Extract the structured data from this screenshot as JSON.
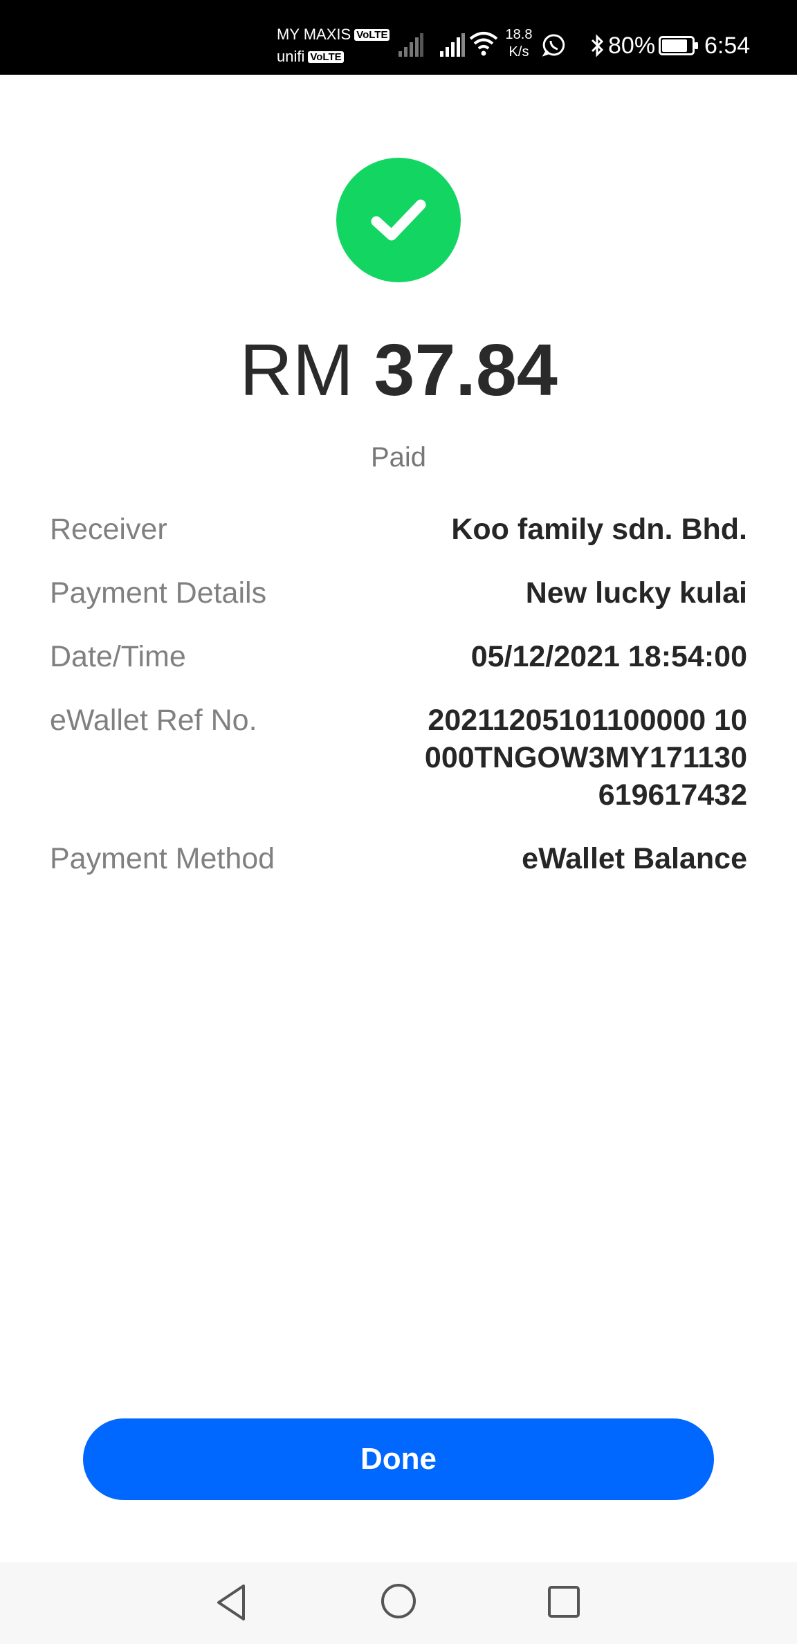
{
  "status_bar": {
    "carrier_1": "MY MAXIS",
    "carrier_2": "unifi",
    "volte_label": "VoLTE",
    "net_speed_value": "18.8",
    "net_speed_unit": "K/s",
    "battery_percent": "80%",
    "time": "6:54"
  },
  "payment": {
    "currency": "RM",
    "amount": "37.84",
    "status": "Paid",
    "status_color": "#12d562"
  },
  "details": {
    "receiver_label": "Receiver",
    "receiver_value": "Koo family sdn. Bhd.",
    "payment_details_label": "Payment Details",
    "payment_details_value": "New lucky kulai",
    "datetime_label": "Date/Time",
    "datetime_value": "05/12/2021 18:54:00",
    "ref_label": "eWallet Ref No.",
    "ref_value": "20211205101100000100 00TNGOW3MY171130619617432",
    "ref_lines": [
      "20211205101100000 10",
      "000TNGOW3MY171130",
      "619617432"
    ],
    "method_label": "Payment Method",
    "method_value": "eWallet Balance"
  },
  "actions": {
    "done_label": "Done",
    "accent_color": "#0067ff"
  },
  "nav": {
    "back_icon": "back-triangle-icon",
    "home_icon": "home-circle-icon",
    "recent_icon": "recent-square-icon"
  }
}
